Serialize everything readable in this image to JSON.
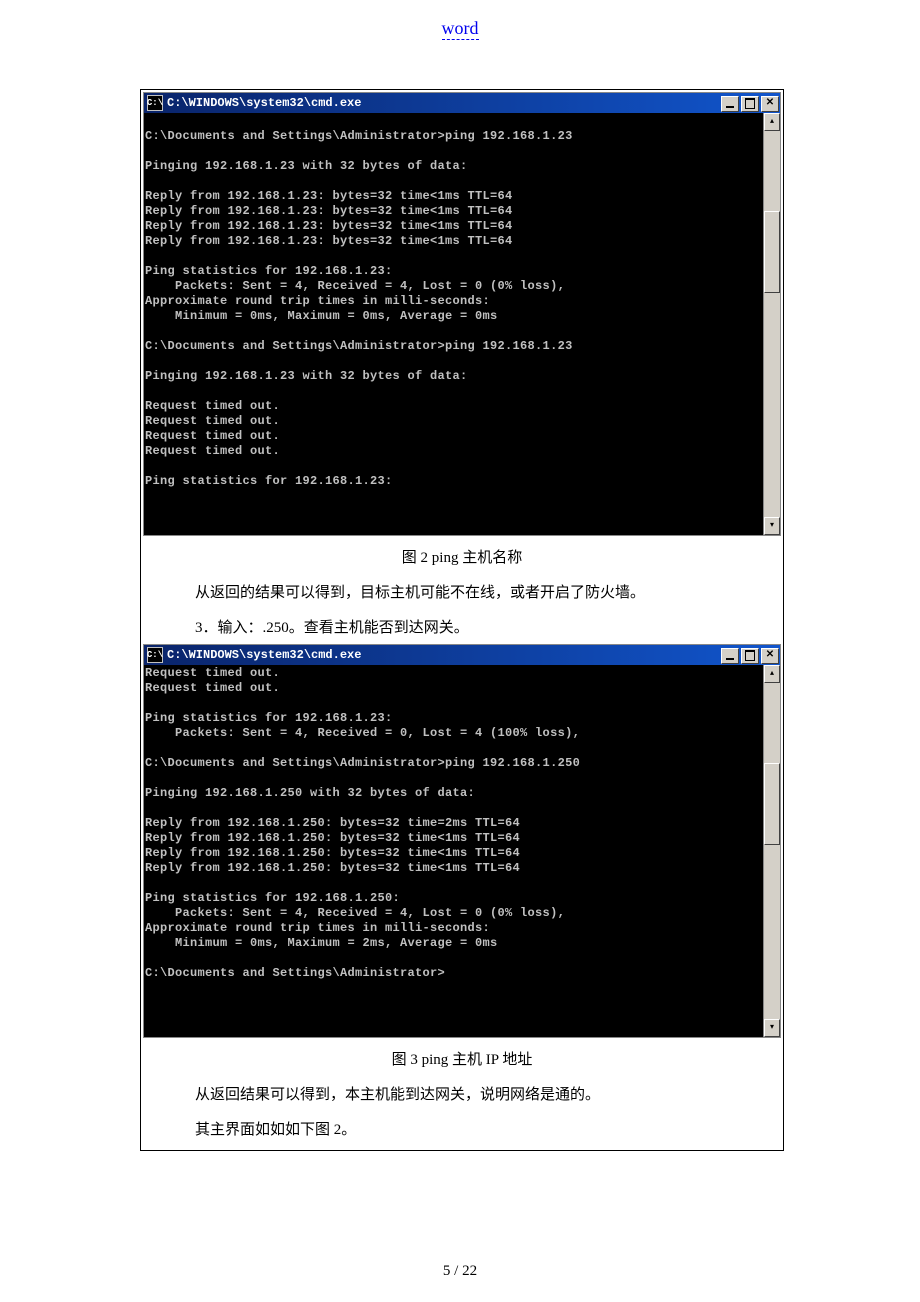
{
  "header": {
    "link": "word"
  },
  "window1": {
    "title": "C:\\WINDOWS\\system32\\cmd.exe",
    "icon_text": "C:\\",
    "body": "\nC:\\Documents and Settings\\Administrator>ping 192.168.1.23\n\nPinging 192.168.1.23 with 32 bytes of data:\n\nReply from 192.168.1.23: bytes=32 time<1ms TTL=64\nReply from 192.168.1.23: bytes=32 time<1ms TTL=64\nReply from 192.168.1.23: bytes=32 time<1ms TTL=64\nReply from 192.168.1.23: bytes=32 time<1ms TTL=64\n\nPing statistics for 192.168.1.23:\n    Packets: Sent = 4, Received = 4, Lost = 0 (0% loss),\nApproximate round trip times in milli-seconds:\n    Minimum = 0ms, Maximum = 0ms, Average = 0ms\n\nC:\\Documents and Settings\\Administrator>ping 192.168.1.23\n\nPinging 192.168.1.23 with 32 bytes of data:\n\nRequest timed out.\nRequest timed out.\nRequest timed out.\nRequest timed out.\n\nPing statistics for 192.168.1.23:"
  },
  "caption1": "图 2 ping 主机名称",
  "para1": "从返回的结果可以得到，目标主机可能不在线，或者开启了防火墙。",
  "para2": "3．输入：.250。查看主机能否到达网关。",
  "window2": {
    "title": "C:\\WINDOWS\\system32\\cmd.exe",
    "icon_text": "C:\\",
    "body": "Request timed out.\nRequest timed out.\n\nPing statistics for 192.168.1.23:\n    Packets: Sent = 4, Received = 0, Lost = 4 (100% loss),\n\nC:\\Documents and Settings\\Administrator>ping 192.168.1.250\n\nPinging 192.168.1.250 with 32 bytes of data:\n\nReply from 192.168.1.250: bytes=32 time=2ms TTL=64\nReply from 192.168.1.250: bytes=32 time<1ms TTL=64\nReply from 192.168.1.250: bytes=32 time<1ms TTL=64\nReply from 192.168.1.250: bytes=32 time<1ms TTL=64\n\nPing statistics for 192.168.1.250:\n    Packets: Sent = 4, Received = 4, Lost = 0 (0% loss),\nApproximate round trip times in milli-seconds:\n    Minimum = 0ms, Maximum = 2ms, Average = 0ms\n\nC:\\Documents and Settings\\Administrator>\n\n\n\n"
  },
  "caption2": "图 3 ping 主机 IP 地址",
  "para3": "从返回结果可以得到，本主机能到达网关，说明网络是通的。",
  "para4": "其主界面如如如下图 2。",
  "footer": "5  /  22"
}
